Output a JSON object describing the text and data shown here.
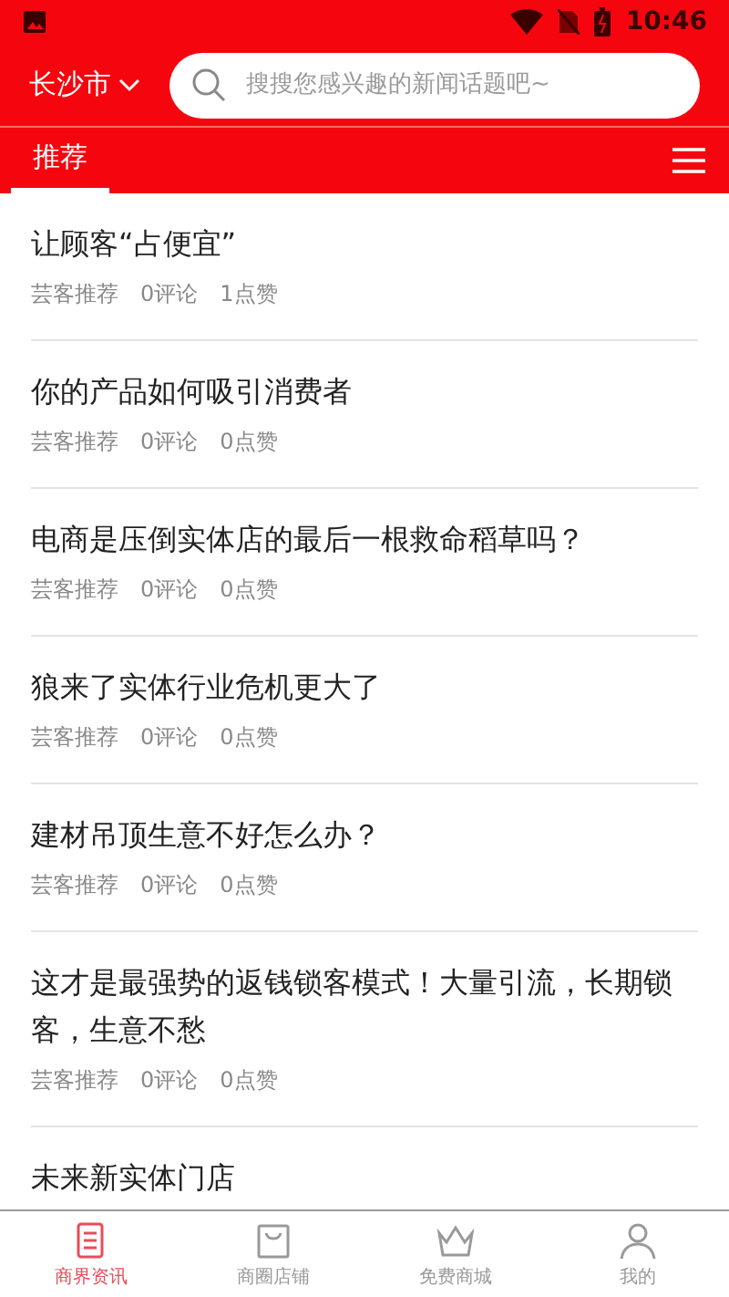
{
  "status_bar": {
    "time": "10:46"
  },
  "header": {
    "city": "长沙市",
    "search": {
      "placeholder": "搜搜您感兴趣的新闻话题吧~"
    }
  },
  "tabs": [
    {
      "label": "推荐",
      "selected": true
    }
  ],
  "articles": [
    {
      "title": "让顾客“占便宜”",
      "source": "芸客推荐",
      "comments": "0评论",
      "likes": "1点赞"
    },
    {
      "title": "你的产品如何吸引消费者",
      "source": "芸客推荐",
      "comments": "0评论",
      "likes": "0点赞"
    },
    {
      "title": "电商是压倒实体店的最后一根救命稻草吗？",
      "source": "芸客推荐",
      "comments": "0评论",
      "likes": "0点赞"
    },
    {
      "title": "狼来了实体行业危机更大了",
      "source": "芸客推荐",
      "comments": "0评论",
      "likes": "0点赞"
    },
    {
      "title": "建材吊顶生意不好怎么办？",
      "source": "芸客推荐",
      "comments": "0评论",
      "likes": "0点赞"
    },
    {
      "title": "这才是最强势的返钱锁客模式！大量引流，长期锁客，生意不愁",
      "source": "芸客推荐",
      "comments": "0评论",
      "likes": "0点赞"
    },
    {
      "title": "未来新实体门店"
    }
  ],
  "bottom_nav": [
    {
      "label": "商界资讯",
      "kind": "news",
      "selected": true
    },
    {
      "label": "商圈店铺",
      "kind": "bag",
      "selected": false
    },
    {
      "label": "免费商城",
      "kind": "crown",
      "selected": false
    },
    {
      "label": "我的",
      "kind": "person",
      "selected": false
    }
  ]
}
